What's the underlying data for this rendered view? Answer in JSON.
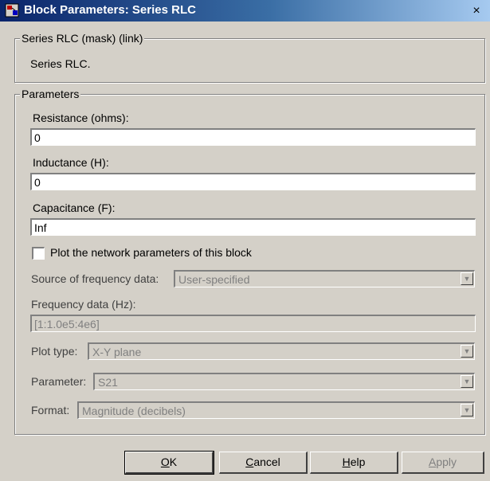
{
  "window": {
    "title": "Block Parameters: Series RLC",
    "close_glyph": "×"
  },
  "mask_group": {
    "legend": "Series RLC (mask) (link)",
    "description": "Series RLC."
  },
  "params_group": {
    "legend": "Parameters",
    "resistance": {
      "label": "Resistance (ohms):",
      "value": "0"
    },
    "inductance": {
      "label": "Inductance (H):",
      "value": "0"
    },
    "capacitance": {
      "label": "Capacitance (F):",
      "value": "Inf"
    },
    "plot_checkbox": {
      "label": "Plot the network parameters of this block",
      "checked": false
    },
    "source_freq": {
      "label": "Source of frequency data:",
      "value": "User-specified"
    },
    "freq_data": {
      "label": "Frequency data (Hz):",
      "value": "[1:1.0e5:4e6]"
    },
    "plot_type": {
      "label": "Plot type:",
      "value": "X-Y plane"
    },
    "parameter": {
      "label": "Parameter:",
      "value": "S21"
    },
    "format": {
      "label": "Format:",
      "value": "Magnitude (decibels)"
    }
  },
  "buttons": {
    "ok": {
      "mnemonic": "O",
      "rest": "K"
    },
    "cancel": {
      "mnemonic": "C",
      "rest": "ancel"
    },
    "help": {
      "mnemonic": "H",
      "rest": "elp"
    },
    "apply": {
      "mnemonic": "A",
      "rest": "pply"
    }
  },
  "icons": {
    "title_icon": "simulink-block-icon",
    "dropdown_arrow": "chevron-down-icon"
  }
}
